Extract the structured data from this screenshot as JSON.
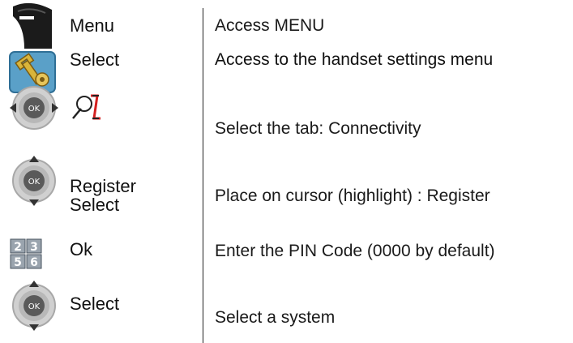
{
  "steps": [
    {
      "icon": "softkey-left-icon",
      "key_lines": [
        "Menu"
      ],
      "description": "Access MENU"
    },
    {
      "icon": "settings-wrench-icon",
      "key_lines": [
        "Select"
      ],
      "description": "Access to the handset settings menu"
    },
    {
      "icon": "navigation-pad-left-right-icon",
      "secondary_icon": "connectivity-tab-icon",
      "key_lines": [],
      "description": "Select the tab: Connectivity"
    },
    {
      "icon": "navigation-pad-up-down-icon",
      "key_lines": [
        "Register",
        "Select"
      ],
      "description": "Place on cursor (highlight) : Register"
    },
    {
      "icon": "keypad-icon",
      "keypad_digits": [
        "2",
        "3",
        "5",
        "6"
      ],
      "key_lines": [
        "Ok"
      ],
      "description": "Enter the PIN Code (0000 by default)"
    },
    {
      "icon": "navigation-pad-up-down-icon",
      "key_lines": [
        "Select"
      ],
      "description": "Select a system"
    }
  ],
  "nav_pad_center_label": "OK",
  "colors": {
    "softkey": "#1b1b1b",
    "wrench_bg": "#5aa0c8",
    "wrench": "#d9b43a",
    "pad_ring": "#b8b8b8",
    "pad_center": "#5a5a5a",
    "keypad_key": "#9aa4ae",
    "connectivity_accent": "#d42020"
  }
}
